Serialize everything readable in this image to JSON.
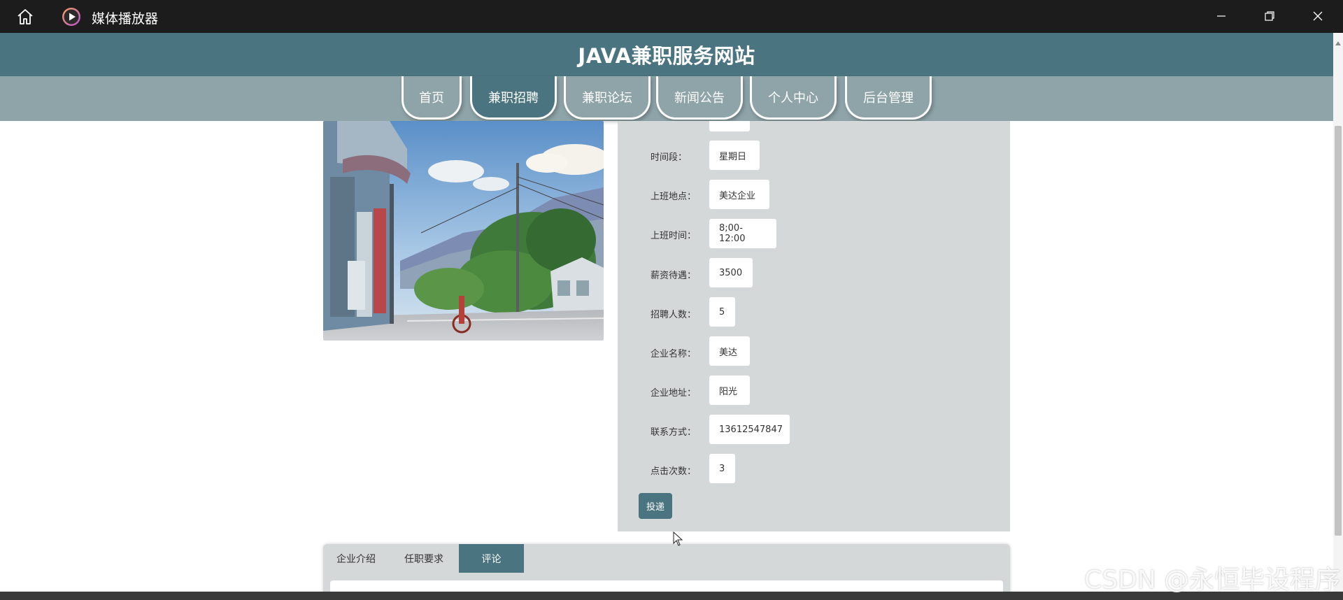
{
  "window": {
    "title": "媒体播放器",
    "icons": {
      "home": "home-icon",
      "app": "media-player-icon",
      "minimize": "minimize-icon",
      "restore": "restore-icon",
      "close": "close-icon"
    }
  },
  "site": {
    "title": "JAVA兼职服务网站"
  },
  "nav": {
    "items": [
      {
        "label": "首页"
      },
      {
        "label": "兼职招聘"
      },
      {
        "label": "兼职论坛"
      },
      {
        "label": "新闻公告"
      },
      {
        "label": "个人中心"
      },
      {
        "label": "后台管理"
      }
    ],
    "active": "兼职招聘"
  },
  "job": {
    "image_description_icon": "job-photo",
    "fields": [
      {
        "label": "时间段：",
        "value": "星期日"
      },
      {
        "label": "上班地点：",
        "value": "美达企业"
      },
      {
        "label": "上班时间：",
        "value": "8;00-12:00"
      },
      {
        "label": "薪资待遇：",
        "value": "3500"
      },
      {
        "label": "招聘人数：",
        "value": "5"
      },
      {
        "label": "企业名称：",
        "value": "美达"
      },
      {
        "label": "企业地址：",
        "value": "阳光"
      },
      {
        "label": "联系方式：",
        "value": "13612547847"
      },
      {
        "label": "点击次数：",
        "value": "3"
      }
    ],
    "apply_label": "投递"
  },
  "tabs": {
    "items": [
      {
        "label": "企业介绍"
      },
      {
        "label": "任职要求"
      },
      {
        "label": "评论"
      }
    ],
    "active": "评论"
  },
  "watermark": "CSDN @永恒毕设程序",
  "colors": {
    "primary": "#4a7480",
    "nav": "#8ea4a9",
    "panel": "#d4d8d9",
    "titlebar": "#1c1c1c"
  }
}
